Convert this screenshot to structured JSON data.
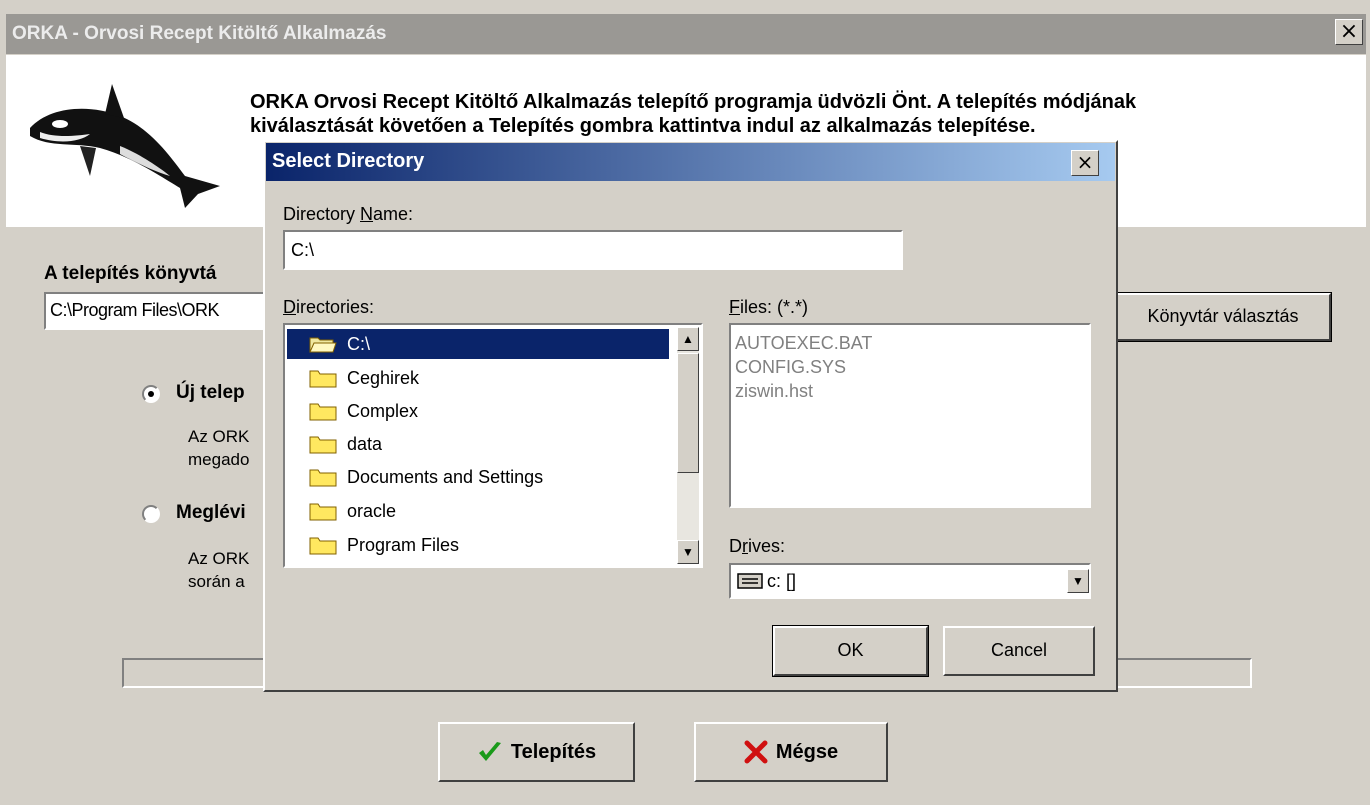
{
  "window": {
    "title": "ORKA - Orvosi Recept Kitöltő Alkalmazás",
    "close_glyph": "×",
    "welcome_line1": "ORKA Orvosi Recept Kitöltő Alkalmazás telepítő programja üdvözli Önt. A telepítés módjának",
    "welcome_line2": "kiválasztását követően a Telepítés gombra kattintva indul az alkalmazás telepítése.",
    "logo_icon": "orca-icon"
  },
  "install": {
    "dir_label": "A telepítés könyvtá",
    "dir_value": "C:\\Program Files\\ORK",
    "choose_button": "Könyvtár választás",
    "option_new_label": "Új telep",
    "option_new_desc1": "Az ORK",
    "option_new_desc2": "megado",
    "option_existing_label": "Meglévi",
    "option_existing_desc1": "Az ORK",
    "option_existing_desc2": "során a",
    "selected_option": "new",
    "install_button": "Telepítés",
    "cancel_button": "Mégse",
    "colors": {
      "check": "#1a9a1a",
      "cross": "#d01010"
    }
  },
  "dialog": {
    "title": "Select Directory",
    "close_glyph": "×",
    "dirname_label_pre": "Directory ",
    "dirname_label_u": "N",
    "dirname_label_post": "ame:",
    "dirname_value": "C:\\",
    "directories_label_u": "D",
    "directories_label_post": "irectories:",
    "files_label_u": "F",
    "files_label_post": "iles: (*.*)",
    "drives_label_pre": "D",
    "drives_label_u": "r",
    "drives_label_post": "ives:",
    "directories": [
      {
        "name": "C:\\",
        "selected": true,
        "open": true
      },
      {
        "name": "Ceghirek"
      },
      {
        "name": "Complex"
      },
      {
        "name": "data"
      },
      {
        "name": "Documents and Settings"
      },
      {
        "name": "oracle"
      },
      {
        "name": "Program Files"
      }
    ],
    "files": [
      "AUTOEXEC.BAT",
      "CONFIG.SYS",
      "ziswin.hst"
    ],
    "drive_value": "c: []",
    "ok_button": "OK",
    "cancel_button": "Cancel"
  }
}
